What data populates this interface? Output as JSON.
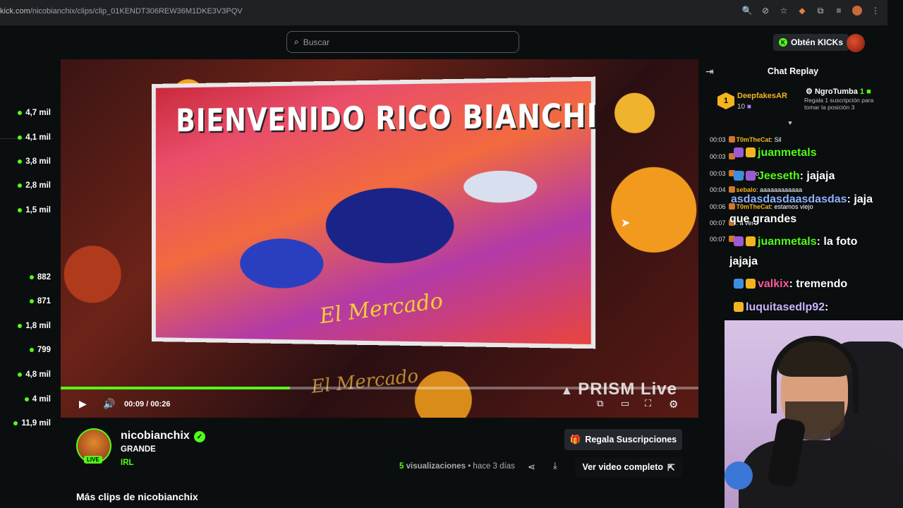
{
  "browser": {
    "url_prefix": "kick.com",
    "url_path": "/nicobianchix/clips/clip_01KENDT306REW36M1DKE3V3PQV"
  },
  "header": {
    "search_placeholder": "Buscar",
    "kicks_button": "Obtén KICKs"
  },
  "sidebar": {
    "viewer_counts": [
      "4,7 mil",
      "4,1 mil",
      "3,8 mil",
      "2,8 mil",
      "1,5 mil",
      "882",
      "871",
      "1,8 mil",
      "799",
      "4,8 mil",
      "4 mil",
      "11,9 mil"
    ]
  },
  "video": {
    "screen_title": "BIENVENIDO RICO BIANCHI",
    "sign_text": "El Mercado",
    "watermark": "PRISM Live",
    "time": "00:09 / 00:26",
    "progress_fraction": 0.36
  },
  "channel": {
    "name": "nicobianchix",
    "clip_title": "GRANDE",
    "category": "IRL",
    "live_badge": "LIVE",
    "gift_button": "Regala Suscripciones",
    "views_count": "5",
    "views_label": "visualizaciones",
    "separator": "•",
    "posted": "hace 3 días",
    "full_video_button": "Ver video completo",
    "more_clips": "Más clips de nicobianchix"
  },
  "chat": {
    "title": "Chat Replay",
    "pinned": {
      "rank": "1",
      "user": "DeepfakesAR",
      "count": "10",
      "gifter": "NgroTumba",
      "gifter_count": "1",
      "gift_desc": "Regala 1 suscripción para tomar la posición 3"
    },
    "small_messages": [
      {
        "time": "00:03",
        "user": "T0mTheCat",
        "text": ": Sil"
      },
      {
        "time": "00:03",
        "user": "",
        "text": ""
      },
      {
        "time": "00:03",
        "user": "",
        "text": ": si viejo"
      },
      {
        "time": "00:04",
        "user": "sebalo",
        "text": ": aaaaaaaaaaaa"
      },
      {
        "time": "00:06",
        "user": "T0mTheCat",
        "text": ": estamos viejo"
      },
      {
        "time": "00:07",
        "user": "",
        "text": ": a ver"
      },
      {
        "time": "00:07",
        "user": "",
        "text": ""
      }
    ],
    "big_messages": [
      {
        "user": "juanmetals",
        "text": ""
      },
      {
        "user": "Jeeseth",
        "text": ": jajaja"
      },
      {
        "user": "asdasdasdaasdasdas",
        "text": ": jaja"
      },
      {
        "user": "",
        "text": "que grandes"
      },
      {
        "user": "juanmetals",
        "text": ": la foto"
      },
      {
        "user": "",
        "text": "jajaja"
      },
      {
        "user": "valkix",
        "text": ": tremendo"
      },
      {
        "user": "luquitasedlp92",
        "text": ":"
      }
    ],
    "colors": {
      "juanmetals": "#53fc18",
      "Jeeseth": "#53fc18",
      "asdasdasdaasdasdas": "#8fb3ff",
      "valkix": "#ff5a9e",
      "luquitasedlp92": "#c9b6ff",
      "T0mTheCat": "#f2b51f",
      "sebalo": "#f2b51f"
    }
  }
}
